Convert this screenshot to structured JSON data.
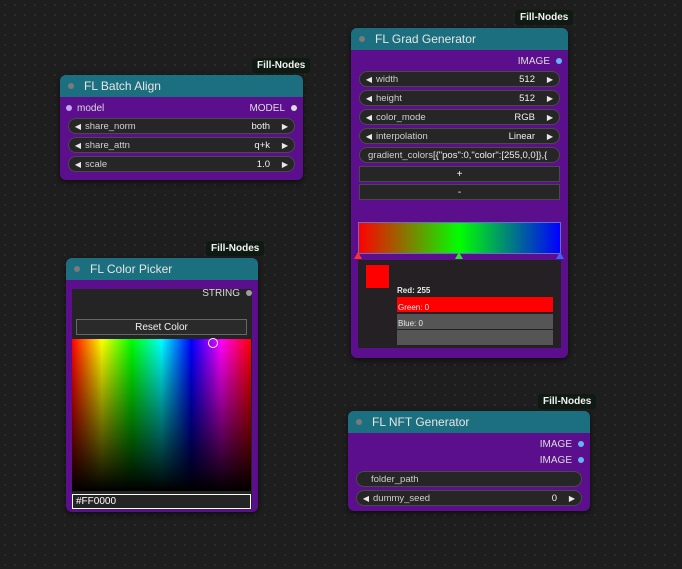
{
  "badges": {
    "batch_align": "Fill-Nodes",
    "grad_gen": "Fill-Nodes",
    "color_picker": "Fill-Nodes",
    "nft_gen": "Fill-Nodes"
  },
  "batch_align": {
    "title": "FL Batch Align",
    "input_label": "model",
    "output_label": "MODEL",
    "widgets": [
      {
        "label": "share_norm",
        "value": "both"
      },
      {
        "label": "share_attn",
        "value": "q+k"
      },
      {
        "label": "scale",
        "value": "1.0"
      }
    ]
  },
  "grad_gen": {
    "title": "FL Grad Generator",
    "output_label": "IMAGE",
    "widgets": [
      {
        "label": "width",
        "value": "512"
      },
      {
        "label": "height",
        "value": "512"
      },
      {
        "label": "color_mode",
        "value": "RGB"
      },
      {
        "label": "interpolation",
        "value": "Linear"
      }
    ],
    "gradient_label": "gradient_colors",
    "gradient_value": "[{\"pos\":0,\"color\":[255,0,0]},{",
    "add_label": "+",
    "remove_label": "-",
    "editor": {
      "red_label": "Red: 255",
      "green_label": "Green: 0",
      "blue_label": "Blue: 0",
      "red_fraction": 1.0,
      "green_fraction": 0.0,
      "blue_fraction": 0.0,
      "swatch_color": "#ff0000"
    },
    "stops": [
      {
        "pos": 0,
        "color": "#ff0000"
      },
      {
        "pos": 0.5,
        "color": "#00ff00"
      },
      {
        "pos": 1,
        "color": "#0000ff"
      }
    ]
  },
  "color_picker": {
    "title": "FL Color Picker",
    "output_label": "STRING",
    "reset_label": "Reset Color",
    "hex_value": "#FF0000",
    "hex_color": "#ff0000"
  },
  "nft_gen": {
    "title": "FL NFT Generator",
    "outputs": [
      "IMAGE",
      "IMAGE"
    ],
    "folder_path_label": "folder_path",
    "seed_label": "dummy_seed",
    "seed_value": "0"
  },
  "colors": {
    "node_body": "#5c0f8c",
    "node_title": "#1c6f7e",
    "model_dot": "#c8a0ff",
    "image_dot": "#64b5f6",
    "string_dot": "#9e9e9e"
  }
}
